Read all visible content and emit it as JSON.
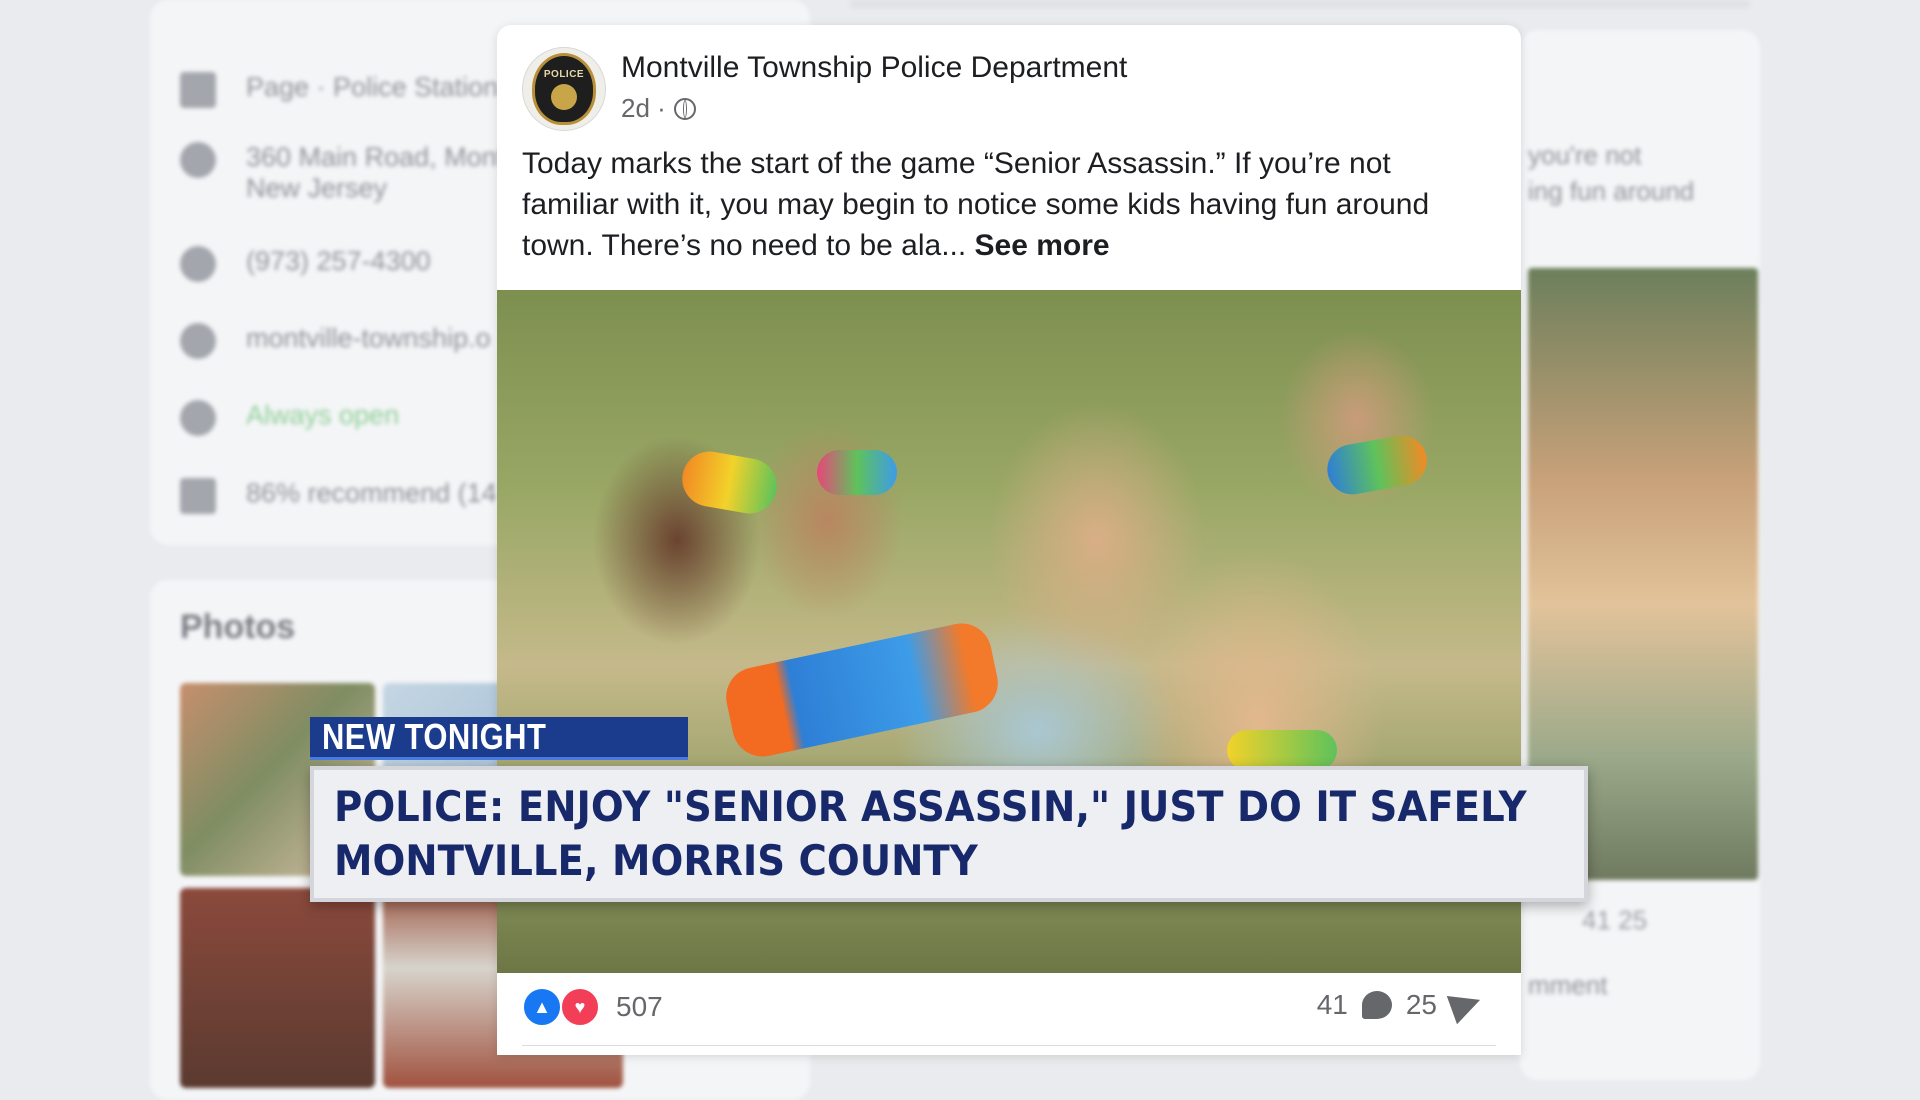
{
  "background": {
    "info": {
      "category": "Page · Police Station",
      "address_line1": "360 Main Road, Mont",
      "address_line2": "New Jersey",
      "phone": "(973) 257-4300",
      "website": "montville-township.o",
      "hours": "Always open",
      "recommend": "86% recommend (14"
    },
    "photos_title": "Photos",
    "right_text_line1": "you're not",
    "right_text_line2": "ing fun around",
    "right_stats": "41  25",
    "right_comment": "mment"
  },
  "post": {
    "page_name": "Montville Township Police Department",
    "avatar_badge_text": "POLICE",
    "time": "2d ·",
    "text": "Today marks the start of the game “Senior Assassin.” If you’re not familiar with it, you may begin to notice some kids having fun around town. There’s no need to be ala...",
    "see_more": "See more",
    "reaction_count": "507",
    "comment_count": "41",
    "share_count": "25",
    "icons": [
      "globe-icon",
      "like-icon",
      "love-icon",
      "comment-icon",
      "share-icon"
    ]
  },
  "lower_third": {
    "kicker": "NEW TONIGHT",
    "headline_line1": "POLICE: ENJOY \"SENIOR ASSASSIN,\" JUST DO IT SAFELY",
    "headline_line2": "MONTVILLE, MORRIS COUNTY",
    "colors": {
      "navy": "#17296b",
      "kicker_bg": "#1b3b8c"
    }
  }
}
